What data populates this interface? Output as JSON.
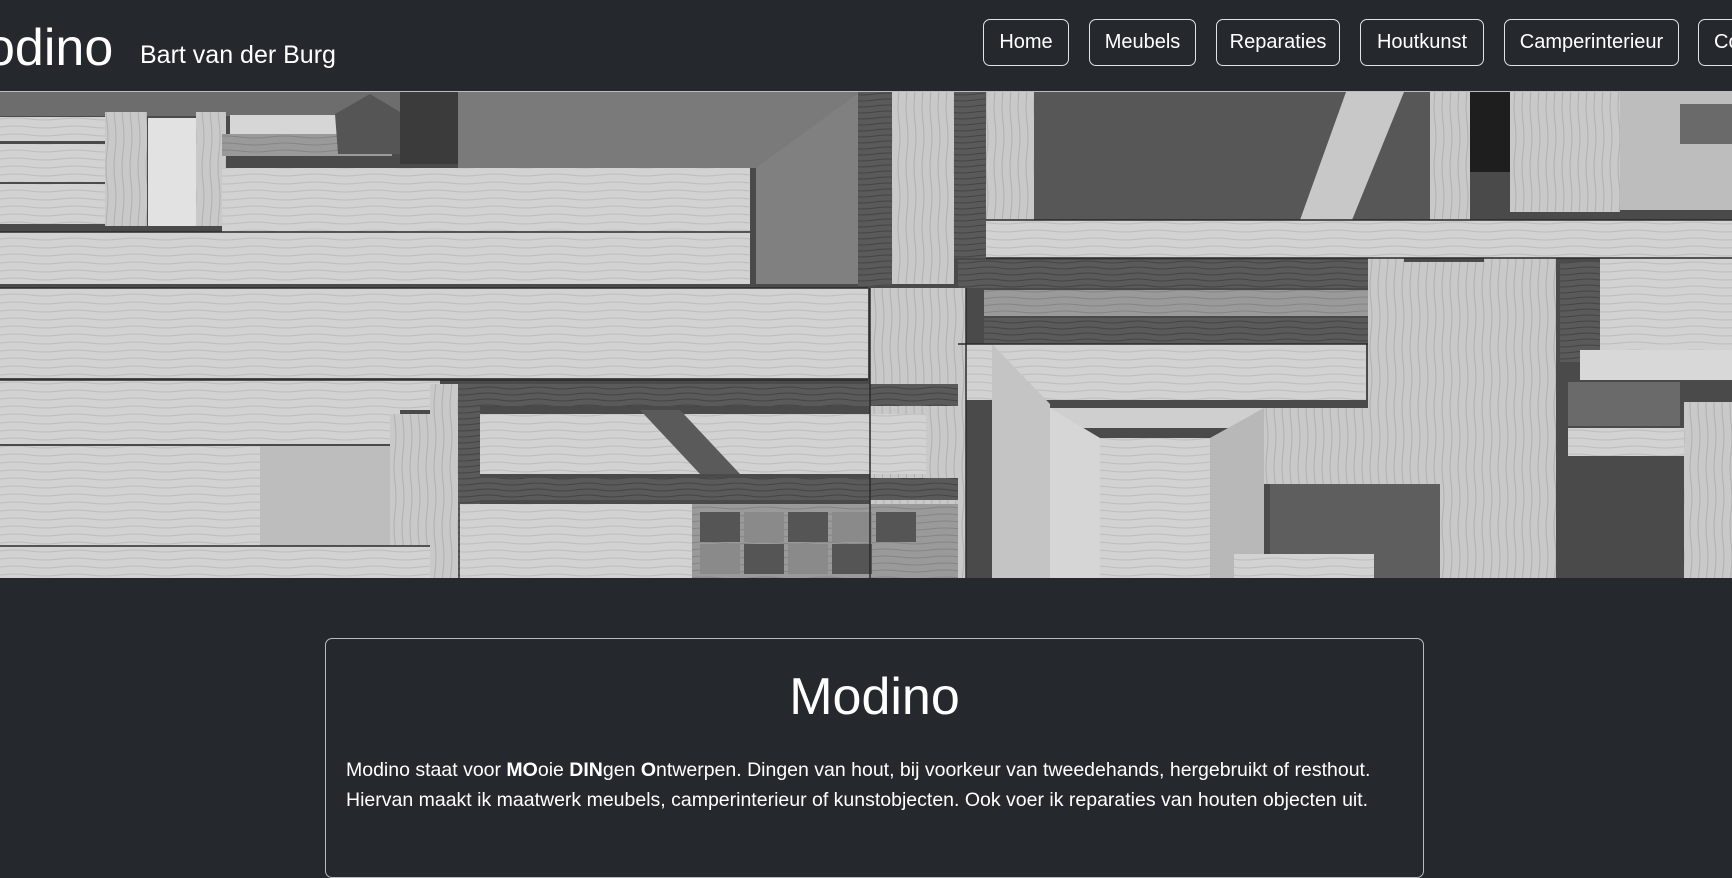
{
  "header": {
    "brand": "odino",
    "subtitle": "Bart van der Burg",
    "nav": [
      {
        "label": "Home"
      },
      {
        "label": "Meubels"
      },
      {
        "label": "Reparaties"
      },
      {
        "label": "Houtkunst"
      },
      {
        "label": "Camperinterieur"
      },
      {
        "label": "Co"
      }
    ]
  },
  "hero": {
    "image": "wood-assemblage-photo-grayscale"
  },
  "intro": {
    "title": "Modino",
    "text_parts": [
      {
        "text": "Modino staat voor ",
        "bold": false
      },
      {
        "text": "MO",
        "bold": true
      },
      {
        "text": "oie ",
        "bold": false
      },
      {
        "text": "DIN",
        "bold": true
      },
      {
        "text": "gen ",
        "bold": false
      },
      {
        "text": "O",
        "bold": true
      },
      {
        "text": "ntwerpen. Dingen van hout, bij voorkeur van tweedehands, hergebruikt of resthout. Hiervan maakt ik maatwerk meubels, camperinterieur of kunstobjecten. Ook voer ik reparaties van houten objecten uit.",
        "bold": false
      }
    ]
  },
  "colors": {
    "background": "#25282d",
    "text": "#ffffff",
    "border": "#dfe2e6"
  }
}
